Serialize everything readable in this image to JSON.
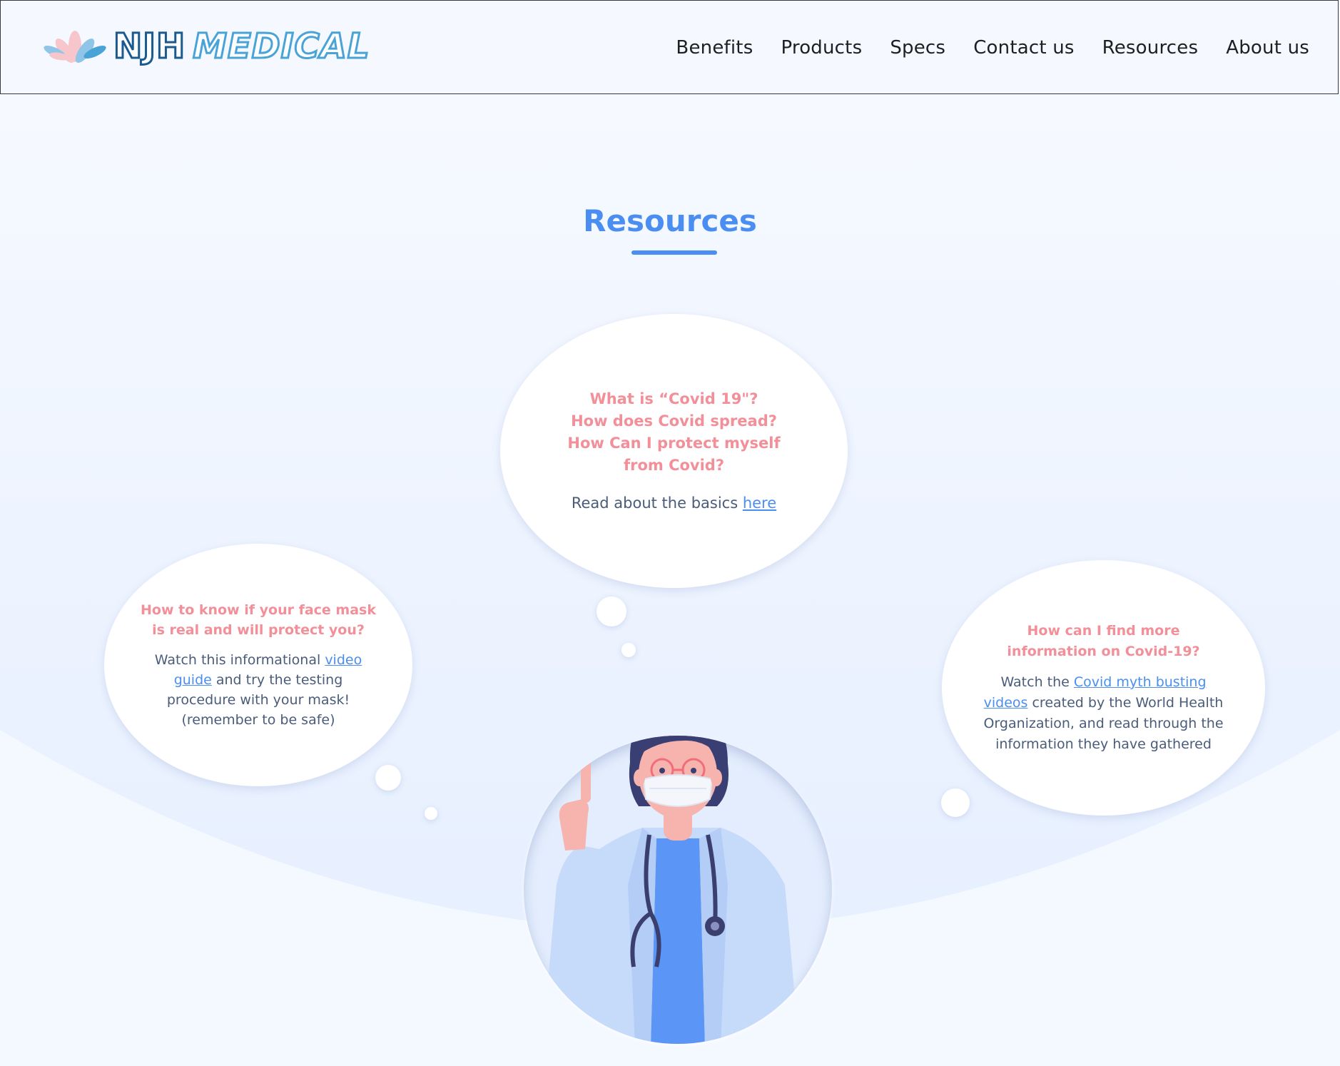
{
  "brand": {
    "name": "NJH MEDICAL",
    "name_part1": "NJH",
    "name_part2": "MEDICAL"
  },
  "nav": {
    "items": [
      "Benefits",
      "Products",
      "Specs",
      "Contact us",
      "Resources",
      "About us"
    ]
  },
  "page": {
    "title": "Resources"
  },
  "bubbles": {
    "center": {
      "q1": "What is “Covid 19\"?",
      "q2": "How does Covid spread?",
      "q3": "How Can I protect myself from Covid?",
      "text": "Read about the basics ",
      "link": "here"
    },
    "left": {
      "question": "How to know if your face mask is real and will protect you?",
      "text_before": "Watch this informational ",
      "link": "video guide",
      "text_after": " and try the testing procedure with your mask! (remember to be safe)"
    },
    "right": {
      "question": "How can I find more information on Covid-19?",
      "text_before": "Watch the ",
      "link": "Covid myth busting videos",
      "text_after": " created by the World Health Organization,  and read through the information they have gathered"
    }
  },
  "colors": {
    "accent": "#4b8ef2",
    "question": "#f28f98",
    "body_text": "#4a5c7a",
    "logo_dark": "#1b5a8f",
    "logo_light": "#4aa3d6"
  },
  "icons": {
    "logo": "lotus-icon",
    "illustration": "doctor-illustration"
  }
}
